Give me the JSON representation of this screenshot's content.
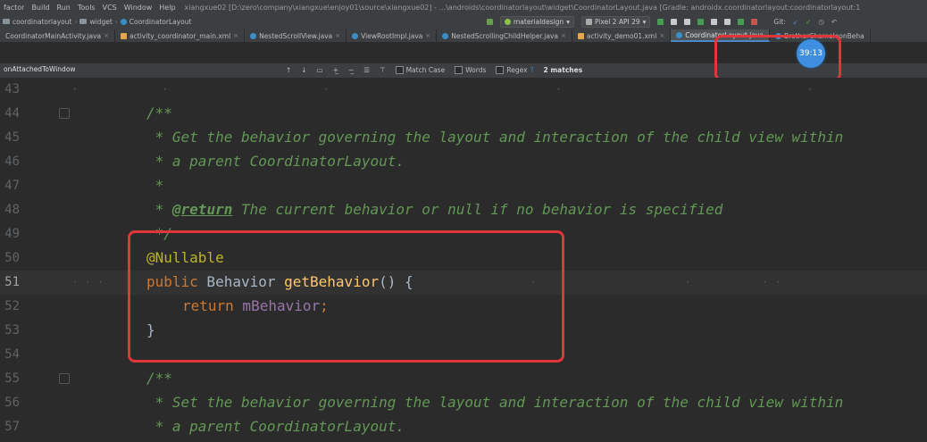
{
  "menu": {
    "items": [
      "factor",
      "Build",
      "Run",
      "Tools",
      "VCS",
      "Window",
      "Help"
    ],
    "window_title": "xiangxue02 [D:\\zero\\company\\xiangxue\\enjoy01\\source\\xiangxue02] - ...\\androids\\coordinatorlayout\\widget\\CoordinatorLayout.java [Gradle: androidx.coordinatorlayout:coordinatorlayout:1"
  },
  "breadcrumbs": [
    "coordinatorlayout",
    "widget",
    "CoordinatorLayout"
  ],
  "toolbar": {
    "module_select": "materialdesign",
    "device_select": "Pixel 2 API 29",
    "git_label": "Git:"
  },
  "tabs": [
    {
      "label": "CoordinatorMainActivity.java",
      "icon": "class"
    },
    {
      "label": "activity_coordinator_main.xml",
      "icon": "xml"
    },
    {
      "label": "NestedScrollView.java",
      "icon": "class"
    },
    {
      "label": "ViewRootImpl.java",
      "icon": "class"
    },
    {
      "label": "NestedScrollingChildHelper.java",
      "icon": "class"
    },
    {
      "label": "activity_demo01.xml",
      "icon": "xml"
    },
    {
      "label": "CoordinatorLayout.java",
      "icon": "class",
      "active": true
    },
    {
      "label": "BrotherChameleonBeha",
      "icon": "class"
    }
  ],
  "search": {
    "query": "onAttachedToWindow",
    "match_case": "Match Case",
    "words": "Words",
    "regex": "Regex",
    "regex_help": "?",
    "matches": "2 matches"
  },
  "timer": "39:13",
  "code_lines": [
    {
      "num": "43"
    },
    {
      "num": "44"
    },
    {
      "num": "45"
    },
    {
      "num": "46"
    },
    {
      "num": "47"
    },
    {
      "num": "48"
    },
    {
      "num": "49"
    },
    {
      "num": "50"
    },
    {
      "num": "51"
    },
    {
      "num": "52"
    },
    {
      "num": "53"
    },
    {
      "num": "54"
    },
    {
      "num": "55"
    },
    {
      "num": "56"
    },
    {
      "num": "57"
    }
  ],
  "code": {
    "l44": "/**",
    "l45": " * Get the behavior governing the layout and interaction of the child view within",
    "l46": " * a parent CoordinatorLayout.",
    "l47": " *",
    "l48_star": " * ",
    "l48_tag": "@return",
    "l48_rest": " The current behavior or null if no behavior is specified",
    "l49": " */",
    "l50": "@Nullable",
    "l51_kw": "public",
    "l51_type": " Behavior ",
    "l51_fn": "getBehavior",
    "l51_rest": "() {",
    "l52_kw": "return",
    "l52_fld": " mBehavior",
    "l52_end": ";",
    "l53": "}",
    "l55": "/**",
    "l56": " * Set the behavior governing the layout and interaction of the child view within",
    "l57": " * a parent CoordinatorLayout."
  },
  "colors": {
    "highlight_box": "#e0353a",
    "timer_bg": "#3f8fe0"
  }
}
